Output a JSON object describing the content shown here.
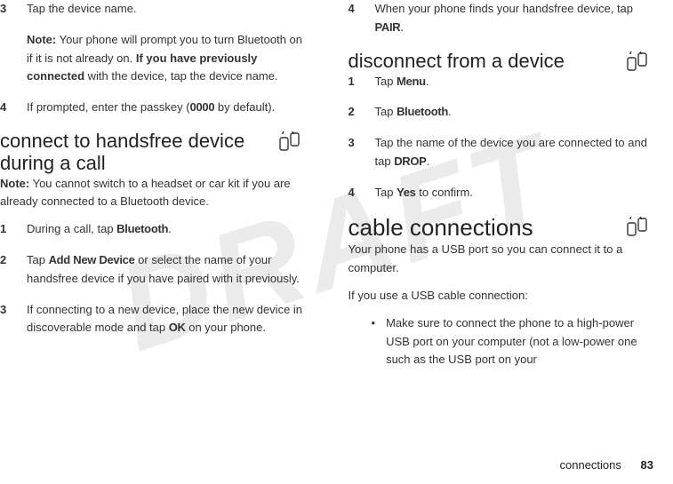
{
  "watermark": "DRAFT",
  "left": {
    "step3": {
      "num": "3",
      "body": "Tap the device name."
    },
    "note3": {
      "label": "Note:",
      "text1": " Your phone will prompt you to turn Bluetooth on if it is not already on. ",
      "bold": "If you have previously connected",
      "text2": " with the device, tap the device name."
    },
    "step4": {
      "num": "4",
      "text1": "If prompted, enter the passkey (",
      "code": "0000",
      "text2": " by default)."
    },
    "heading_handsfree": "connect to handsfree device during a call",
    "note_handsfree": {
      "label": "Note:",
      "text": " You cannot switch to a headset or car kit if you are already connected to a Bluetooth device."
    },
    "hf1": {
      "num": "1",
      "text1": "During a call, tap ",
      "bold": "Bluetooth",
      "text2": "."
    },
    "hf2": {
      "num": "2",
      "text1": "Tap ",
      "bold": "Add New Device",
      "text2": " or select the name of your handsfree device if you have paired with it previously."
    },
    "hf3": {
      "num": "3",
      "text1": "If connecting to a new device, place the new device in discoverable mode and tap ",
      "bold": "OK",
      "text2": " on your phone."
    }
  },
  "right": {
    "step4": {
      "num": "4",
      "text1": "When your phone finds your handsfree device, tap ",
      "bold": "PAIR",
      "text2": "."
    },
    "heading_disconnect": "disconnect from a device",
    "d1": {
      "num": "1",
      "text1": "Tap ",
      "bold": "Menu",
      "text2": "."
    },
    "d2": {
      "num": "2",
      "text1": "Tap ",
      "bold": "Bluetooth",
      "text2": "."
    },
    "d3": {
      "num": "3",
      "text1": "Tap the name of the device you are connected to and tap ",
      "bold": "DROP",
      "text2": "."
    },
    "d4": {
      "num": "4",
      "text1": "Tap ",
      "bold": "Yes",
      "text2": " to confirm."
    },
    "heading_cable": "cable connections",
    "cable_p1": "Your phone has a USB port so you can connect it to a computer.",
    "cable_p2": "If you use a USB cable connection:",
    "cable_b1": "Make sure to connect the phone to a high-power USB port on your computer (not a low-power one such as the USB port on your"
  },
  "footer": {
    "section": "connections",
    "page": "83"
  }
}
